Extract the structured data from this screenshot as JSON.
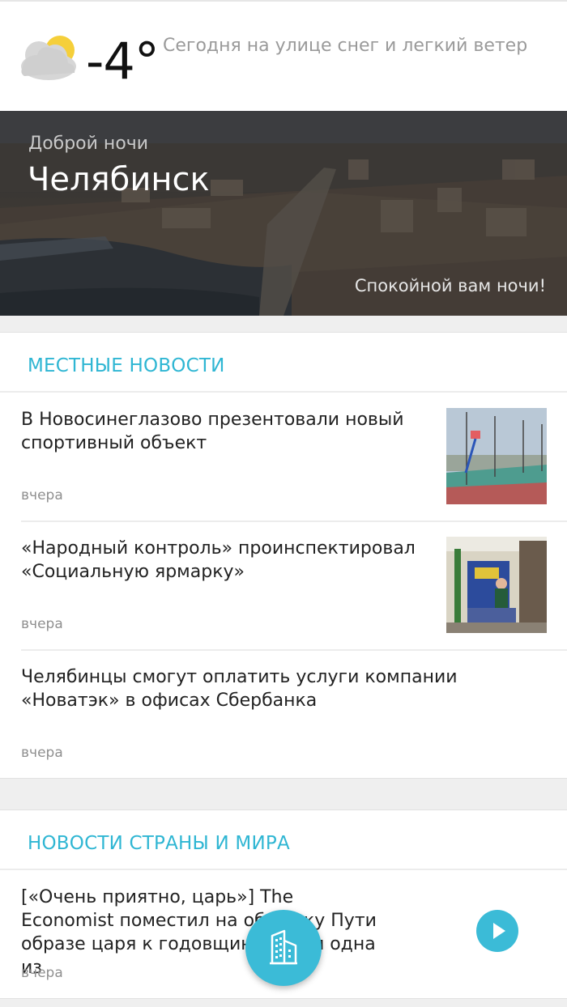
{
  "weather": {
    "temperature": "-4°",
    "description": "Сегодня на улице снег и легкий ветер",
    "icon": "cloud-sun-icon"
  },
  "hero": {
    "greeting": "Доброй ночи",
    "city": "Челябинск",
    "wish": "Спокойной вам ночи!"
  },
  "local_news": {
    "title": "МЕСТНЫЕ НОВОСТИ",
    "items": [
      {
        "title": "В Новосинеглазово презентовали новый спортивный объект",
        "date": "вчера"
      },
      {
        "title": "«Народный контроль» проинспектировал «Социальную ярмарку»",
        "date": "вчера"
      },
      {
        "title": "Челябинцы смогут оплатить услуги компании «Новатэк» в офисах Сбербанка",
        "date": "вчера"
      }
    ]
  },
  "world_news": {
    "title": "НОВОСТИ СТРАНЫ И МИРА",
    "items": [
      {
        "title": "[«Очень приятно, царь»] The Economist поместил на обложку Пути   образе царя к годовщине револ       одна из",
        "date": "вчера"
      }
    ]
  },
  "colors": {
    "accent": "#3bbbd7",
    "section_title": "#2fb6d3"
  },
  "fab": {
    "icon": "buildings-icon"
  },
  "play": {
    "icon": "play-icon"
  }
}
